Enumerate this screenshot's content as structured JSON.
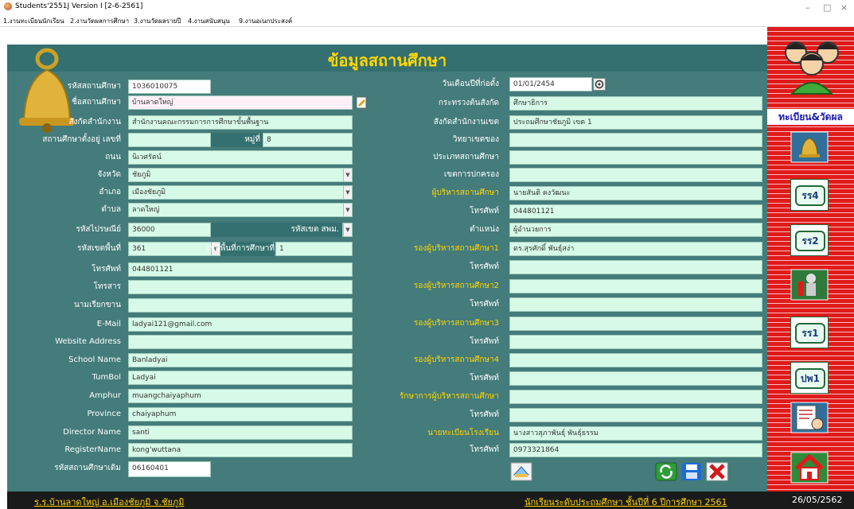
{
  "window": {
    "title": "Students'2551J Version I [2-6-2561]",
    "controls": [
      "–",
      "□",
      "×"
    ]
  },
  "menu": [
    "1.งานทะเบียนนักเรียน",
    "2.งานวัดผลการศึกษา",
    "3.งานวัดผลรายปี",
    "4.งานสนับสนุน",
    "9.งานอเนกประสงค์"
  ],
  "header": {
    "title": "ข้อมูลสถานศึกษา"
  },
  "left_fields": {
    "school_code": {
      "label": "รหัสสถานศึกษา",
      "value": "1036010075"
    },
    "school_name": {
      "label": "ชื่อสถานศึกษา",
      "value": "บ้านลาดใหญ่"
    },
    "affiliation": {
      "label": "สังกัดสำนักงาน",
      "value": "สำนักงานคณะกรรมการการศึกษาขั้นพื้นฐาน"
    },
    "address_no": {
      "label": "สถานศึกษาตั้งอยู่ เลขที่",
      "value": ""
    },
    "moo": {
      "label": "หมู่ที่",
      "value": "8"
    },
    "road": {
      "label": "ถนน",
      "value": "นิเวศรัตน์"
    },
    "province_th": {
      "label": "จังหวัด",
      "value": "ชัยภูมิ"
    },
    "district_th": {
      "label": "อำเภอ",
      "value": "เมืองชัยภูมิ"
    },
    "subdistrict_th": {
      "label": "ตำบล",
      "value": "ลาดใหญ่"
    },
    "postcode": {
      "label": "รหัสไปรษณีย์",
      "value": "36000"
    },
    "spm_code": {
      "label": "รหัสเขต สพม.",
      "value": ""
    },
    "area_code": {
      "label": "รหัสเขตพื้นที่",
      "value": "361"
    },
    "edu_area": {
      "label": "เขตพื้นที่การศึกษาที่",
      "value": "1"
    },
    "phone": {
      "label": "โทรศัพท์",
      "value": "044801121"
    },
    "fax": {
      "label": "โทรสาร",
      "value": ""
    },
    "nickname": {
      "label": "นามเรียกขาน",
      "value": ""
    },
    "email": {
      "label": "E-Mail",
      "value": "ladyai121@gmail.com"
    },
    "website": {
      "label": "Website Address",
      "value": ""
    },
    "school_name_en": {
      "label": "School Name",
      "value": "Banladyai"
    },
    "tumbol_en": {
      "label": "TumBol",
      "value": "Ladyai"
    },
    "amphur_en": {
      "label": "Amphur",
      "value": "muangchaiyaphum"
    },
    "province_en": {
      "label": "Province",
      "value": "chaiyaphum"
    },
    "director_en": {
      "label": "Director Name",
      "value": "santi"
    },
    "register_en": {
      "label": "RegisterName",
      "value": "kong'wuttana"
    },
    "old_code": {
      "label": "รหัสสถานศึกษาเดิม",
      "value": "06160401"
    }
  },
  "right_fields": {
    "founded": {
      "label": "วันเดือนปีที่ก่อตั้ง",
      "value": "01/01/2454"
    },
    "ministry": {
      "label": "กระทรวงต้นสังกัด",
      "value": "ศึกษาธิการ"
    },
    "area_office": {
      "label": "สังกัดสำนักงานเขต",
      "value": "ประถมศึกษาชัยภูมิ เขต 1"
    },
    "area_of": {
      "label": "วิทยาเขตของ",
      "value": ""
    },
    "school_type": {
      "label": "ประเภทสถานศึกษา",
      "value": ""
    },
    "admin_zone": {
      "label": "เขตการปกครอง",
      "value": ""
    },
    "director": {
      "label": "ผู้บริหารสถานศึกษา",
      "value": "นายสันติ คงวัฒนะ"
    },
    "director_phone": {
      "label": "โทรศัพท์",
      "value": "044801121"
    },
    "position": {
      "label": "ตำแหน่ง",
      "value": "ผู้อำนวยการ"
    },
    "deputy1": {
      "label": "รองผู้บริหารสถานศึกษา1",
      "value": "ดร.สุรศักดิ์ พันธุ์สง่า"
    },
    "deputy1_phone": {
      "label": "โทรศัพท์",
      "value": ""
    },
    "deputy2": {
      "label": "รองผู้บริหารสถานศึกษา2",
      "value": ""
    },
    "deputy2_phone": {
      "label": "โทรศัพท์",
      "value": ""
    },
    "deputy3": {
      "label": "รองผู้บริหารสถานศึกษา3",
      "value": ""
    },
    "deputy3_phone": {
      "label": "โทรศัพท์",
      "value": ""
    },
    "deputy4": {
      "label": "รองผู้บริหารสถานศึกษา4",
      "value": ""
    },
    "deputy4_phone": {
      "label": "โทรศัพท์",
      "value": ""
    },
    "acting": {
      "label": "รักษาการผู้บริหารสถานศึกษา",
      "value": ""
    },
    "acting_phone": {
      "label": "โทรศัพท์",
      "value": ""
    },
    "registrar": {
      "label": "นายทะเบียนโรงเรียน",
      "value": "นางสาวสุภาพันธุ์ พันธุ์ธรรม"
    },
    "registrar_phone": {
      "label": "โทรศัพท์",
      "value": "0973321864"
    }
  },
  "sidebar": {
    "label": "ทะเบียน&วัดผล",
    "buttons": [
      "รร4",
      "รร2",
      "รร1",
      "ปพ1"
    ]
  },
  "status": {
    "left": "ร.ร.บ้านลาดใหญ่ อ.เมืองชัยภูมิ จ.ชัยภูมิ",
    "right": "นักเรียนระดับประถมศึกษา ชั้นปีที่ 6 ปีการศึกษา 2561",
    "date": "26/05/2562"
  },
  "colors": {
    "panel": "#447b7b",
    "header": "#357070",
    "field": "#d7fae8",
    "accent": "#ffd700",
    "sidebar": "#e11a1a"
  }
}
